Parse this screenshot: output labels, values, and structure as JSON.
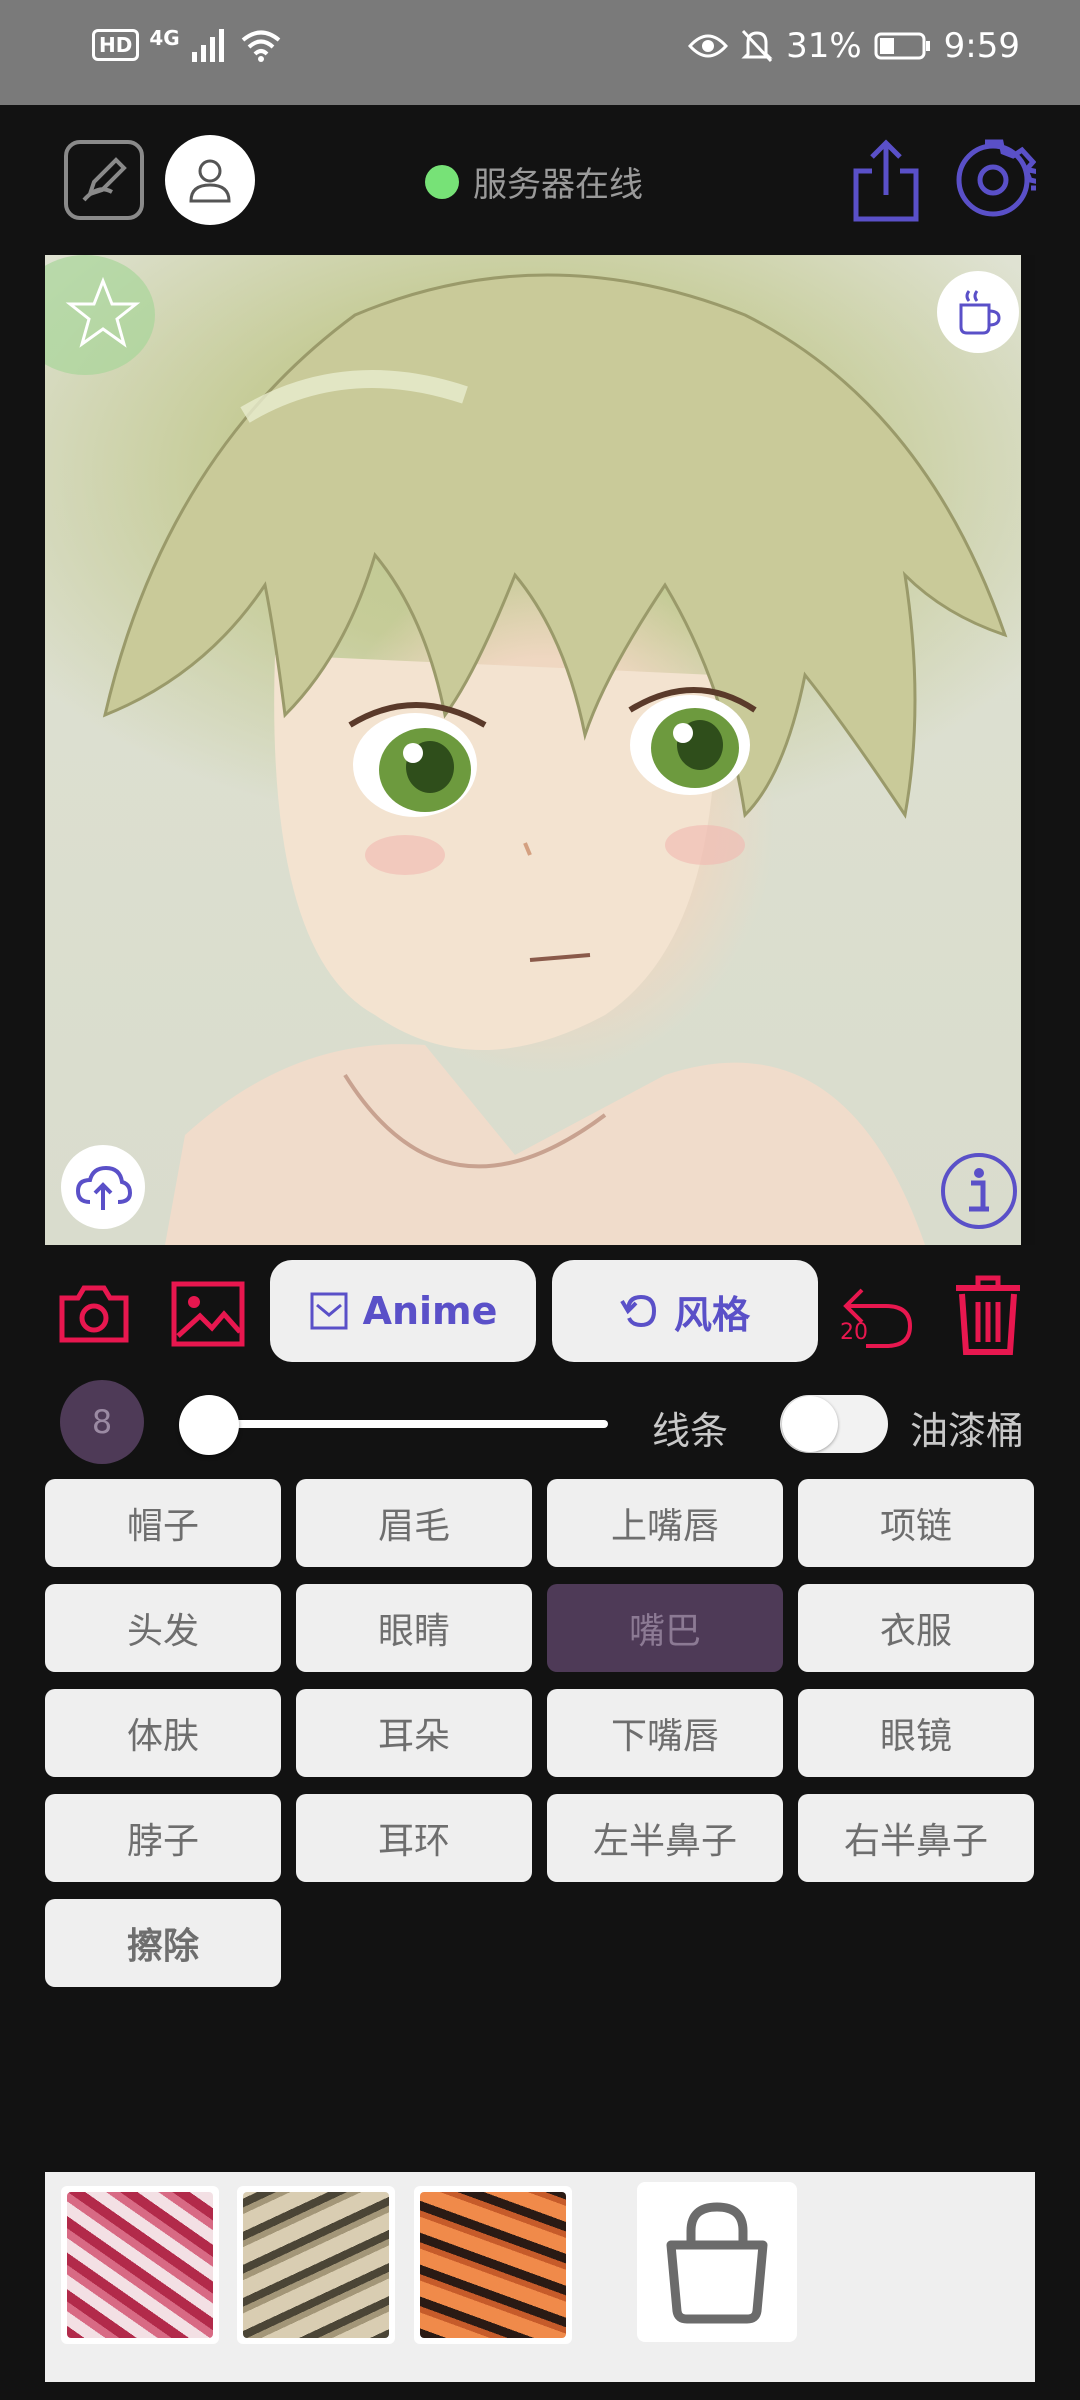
{
  "status_bar": {
    "hd": "HD",
    "network": "4G",
    "battery": "31%",
    "time": "9:59"
  },
  "toolbar": {
    "server_status": "服务器在线",
    "server_status_color": "#77e277"
  },
  "actions": {
    "anime_label": "Anime",
    "style_label": "风格",
    "undo_count": "20"
  },
  "brush": {
    "size": "8",
    "line_label": "线条",
    "bucket_label": "油漆桶",
    "slider_value": 0.05,
    "bucket_enabled": false
  },
  "parts": [
    {
      "label": "帽子"
    },
    {
      "label": "眉毛"
    },
    {
      "label": "上嘴唇"
    },
    {
      "label": "项链"
    },
    {
      "label": "头发"
    },
    {
      "label": "眼睛"
    },
    {
      "label": "嘴巴",
      "selected": true
    },
    {
      "label": "衣服"
    },
    {
      "label": "体肤"
    },
    {
      "label": "耳朵"
    },
    {
      "label": "下嘴唇"
    },
    {
      "label": "眼镜"
    },
    {
      "label": "脖子"
    },
    {
      "label": "耳环"
    },
    {
      "label": "左半鼻子"
    },
    {
      "label": "右半鼻子"
    },
    {
      "label": "擦除"
    }
  ],
  "colors": {
    "accent_red": "#e8174f",
    "accent_purple": "#5a50c8",
    "selected_part": "#4e3a57"
  },
  "icons": {
    "canvas": [
      "star-icon",
      "coffee-cup-icon",
      "cloud-upload-icon",
      "info-icon"
    ],
    "toolbar": [
      "pencil-square-icon",
      "user-icon",
      "share-icon",
      "gear-icon"
    ],
    "actions": [
      "camera-icon",
      "image-icon",
      "envelope-icon",
      "rotate-icon",
      "undo-icon",
      "trash-icon"
    ],
    "textures": [
      "bag-icon"
    ]
  }
}
